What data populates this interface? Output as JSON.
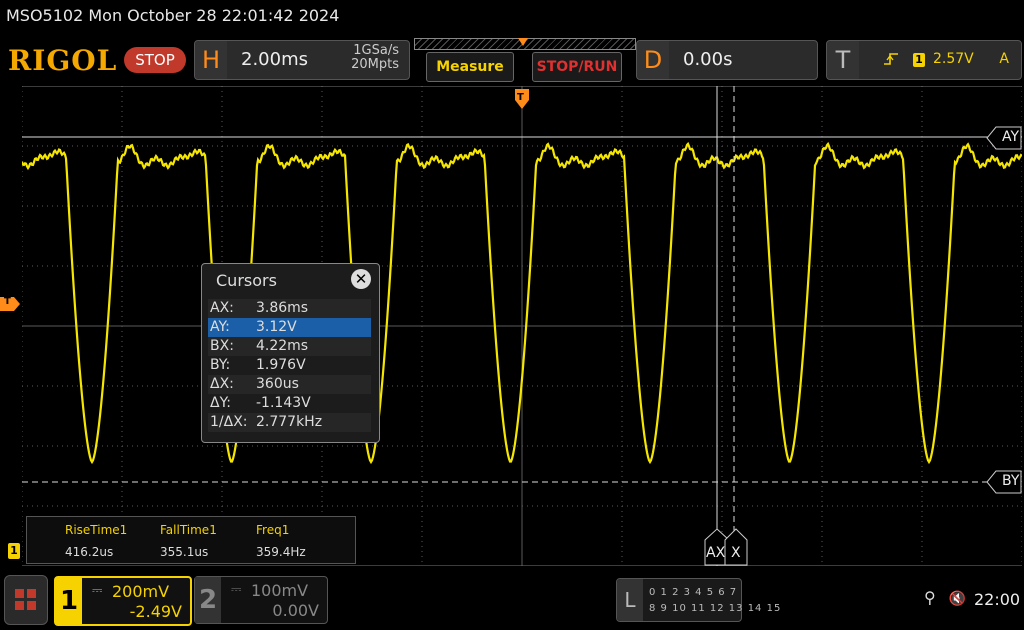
{
  "top": {
    "device_datetime": "MSO5102  Mon October 28 22:01:42 2024"
  },
  "header": {
    "brand": "RIGOL",
    "run_state": "STOP",
    "horizontal": {
      "tag": "H",
      "timebase": "2.00ms",
      "sample_rate": "1GSa/s",
      "memory_depth": "20Mpts"
    },
    "measure_label": "Measure",
    "stop_run_label": "STOP/RUN",
    "delay": {
      "tag": "D",
      "value": "0.00s"
    },
    "trigger": {
      "tag": "T",
      "edge_icon": "rising-edge-icon",
      "source": "1",
      "level": "2.57V",
      "mode": "A"
    }
  },
  "screen": {
    "trigger_marker": "T",
    "cursor_labels": {
      "ay": "AY",
      "by": "BY",
      "ax": "AX",
      "bx": "X"
    },
    "colors": {
      "trace": "#f5e600",
      "grid": "#5a5a5a",
      "cursor": "#dddddd"
    }
  },
  "cursors": {
    "title": "Cursors",
    "close_icon": "close-icon",
    "rows": [
      {
        "key": "AX:",
        "value": "3.86ms"
      },
      {
        "key": "AY:",
        "value": "3.12V"
      },
      {
        "key": "BX:",
        "value": "4.22ms"
      },
      {
        "key": "BY:",
        "value": "1.976V"
      },
      {
        "key": "ΔX:",
        "value": "360us"
      },
      {
        "key": "ΔY:",
        "value": "-1.143V"
      },
      {
        "key": "1/ΔX:",
        "value": "2.777kHz"
      }
    ],
    "selected_index": 1
  },
  "measurements": {
    "channel_badge": "1",
    "items": [
      {
        "label": "RiseTime1",
        "value": "416.2us"
      },
      {
        "label": "FallTime1",
        "value": "355.1us"
      },
      {
        "label": "Freq1",
        "value": "359.4Hz"
      }
    ]
  },
  "channels": [
    {
      "number": "1",
      "coupling_icon": "dc-coupling-icon",
      "coupling": "⎓",
      "vdiv": "200mV",
      "offset": "-2.49V",
      "active": true
    },
    {
      "number": "2",
      "coupling_icon": "dc-coupling-icon",
      "coupling": "⎓",
      "vdiv": "100mV",
      "offset": "0.00V",
      "active": false
    }
  ],
  "logic": {
    "tag": "L",
    "row1": "0 1 2 3   4 5 6 7",
    "row2": "8 9 10 11  12 13 14 15"
  },
  "status": {
    "usb_icon": "usb-icon",
    "usb": "⚲",
    "sound_icon": "speaker-muted-icon",
    "sound": "🔇",
    "clock": "22:00"
  }
}
